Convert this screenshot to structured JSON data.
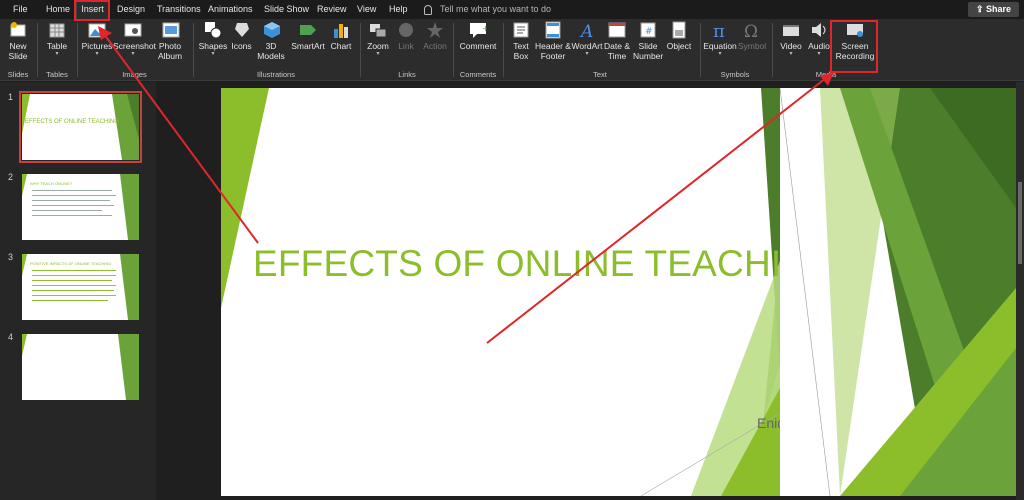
{
  "menu": {
    "tabs": [
      "File",
      "Home",
      "Insert",
      "Design",
      "Transitions",
      "Animations",
      "Slide Show",
      "Review",
      "View",
      "Help"
    ],
    "active_tab": "Insert",
    "tell_me": "Tell me what you want to do",
    "share": "Share"
  },
  "ribbon": {
    "new_slide": "New Slide",
    "table": "Table",
    "pictures": "Pictures",
    "screenshot": "Screenshot",
    "photo_album": "Photo Album",
    "shapes": "Shapes",
    "icons": "Icons",
    "models_3d": "3D Models",
    "smartart": "SmartArt",
    "chart": "Chart",
    "zoom": "Zoom",
    "link": "Link",
    "action": "Action",
    "comment": "Comment",
    "text_box": "Text Box",
    "header_footer": "Header & Footer",
    "wordart": "WordArt",
    "date_time": "Date & Time",
    "slide_number": "Slide Number",
    "object": "Object",
    "equation": "Equation",
    "symbol": "Symbol",
    "video": "Video",
    "audio": "Audio",
    "screen_recording": "Screen Recording",
    "groups": {
      "slides": "Slides",
      "tables": "Tables",
      "images": "Images",
      "illustrations": "Illustrations",
      "links": "Links",
      "comments": "Comments",
      "text": "Text",
      "symbols": "Symbols",
      "media": "Media"
    }
  },
  "thumbnails": {
    "numbers": [
      "1",
      "2",
      "3",
      "4"
    ],
    "slide1_title": "EFFECTS OF ONLINE TEACHING",
    "slide2_title": "WHY TEACH ONLINE?",
    "slide3_title": "POSITIVE IMPACTS OF ONLINE TEACHING"
  },
  "slide": {
    "title": "EFFECTS OF ONLINE TEACHING",
    "subtitle": "Enid"
  },
  "colors": {
    "accent_green": "#8cbe2c",
    "annotation_red": "#e0262b",
    "ribbon_bg": "#2c2c2c"
  }
}
